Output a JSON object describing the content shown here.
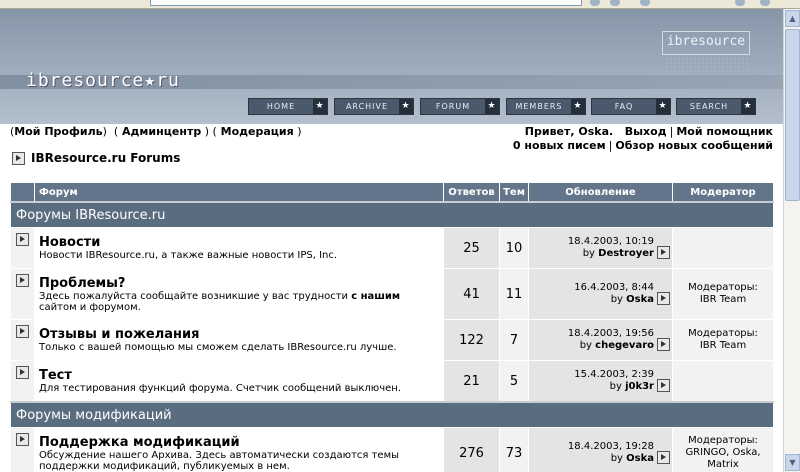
{
  "banner": {
    "logo": "ibresource★ru",
    "brand": "ibresource",
    "nav": [
      {
        "label": "HOME"
      },
      {
        "label": "ARCHIVE"
      },
      {
        "label": "FORUM"
      },
      {
        "label": "MEMBERS"
      },
      {
        "label": "FAQ"
      },
      {
        "label": "SEARCH"
      }
    ]
  },
  "userbar": {
    "profile": "Мой Профиль",
    "admin": "Админцентр",
    "moderation": "Модерация",
    "greeting": "Привет, Oska.",
    "logout": "Выход",
    "assistant": "Мой помощник",
    "new_messages": "0 новых писем",
    "new_posts": "Обзор новых сообщений"
  },
  "breadcrumb": "IBResource.ru Forums",
  "table": {
    "headers": {
      "forum": "Форум",
      "replies": "Ответов",
      "topics": "Тем",
      "update": "Обновление",
      "moderator": "Модератор"
    },
    "categories": [
      {
        "title": "Форумы IBResource.ru",
        "forums": [
          {
            "title": "Новости",
            "desc": "Новости IBResource.ru, а также важные новости IPS, Inc.",
            "desc_bold": "",
            "desc_tail": "",
            "replies": "25",
            "topics": "10",
            "date": "18.4.2003, 10:19",
            "by": "by",
            "author": "Destroyer",
            "mod_label": "",
            "mods": ""
          },
          {
            "title": "Проблемы?",
            "desc": "Здесь пожалуйста сообщайте возникшие у вас трудности ",
            "desc_bold": "с нашим",
            "desc_tail": " сайтом и форумом.",
            "replies": "41",
            "topics": "11",
            "date": "16.4.2003, 8:44",
            "by": "by",
            "author": "Oska",
            "mod_label": "Модераторы:",
            "mods": "IBR Team"
          },
          {
            "title": "Отзывы и пожелания",
            "desc": "Только с вашей помощью мы сможем сделать IBResource.ru лучше.",
            "desc_bold": "",
            "desc_tail": "",
            "replies": "122",
            "topics": "7",
            "date": "18.4.2003, 19:56",
            "by": "by",
            "author": "chegevaro",
            "mod_label": "Модераторы:",
            "mods": "IBR Team"
          },
          {
            "title": "Тест",
            "desc": "Для тестирования функций форума. Счетчик сообщений выключен.",
            "desc_bold": "",
            "desc_tail": "",
            "replies": "21",
            "topics": "5",
            "date": "15.4.2003, 2:39",
            "by": "by",
            "author": "j0k3r",
            "mod_label": "",
            "mods": ""
          }
        ]
      },
      {
        "title": "Форумы модификаций",
        "forums": [
          {
            "title": "Поддержка модификаций",
            "desc": "Обсуждение нашего Архива. Здесь автоматически создаются темы поддержки модификаций, публикуемых в нем.",
            "desc_bold": "",
            "desc_tail": "",
            "replies": "276",
            "topics": "73",
            "date": "18.4.2003, 19:28",
            "by": "by",
            "author": "Oska",
            "mod_label": "Модераторы:",
            "mods": "GRINGO, Oska, Matrix"
          }
        ]
      }
    ]
  }
}
